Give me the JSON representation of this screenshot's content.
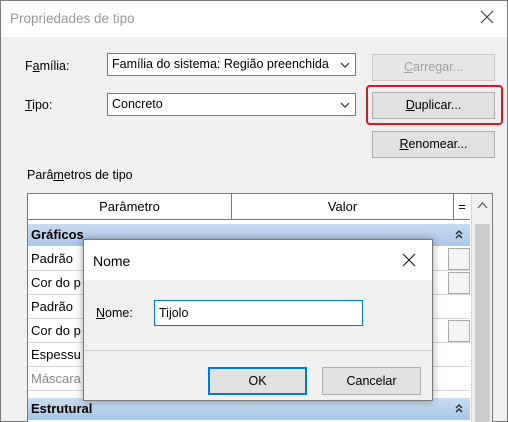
{
  "window": {
    "title": "Propriedades de tipo"
  },
  "familia": {
    "label_pre": "F",
    "label_u": "a",
    "label_post": "mília:",
    "value": "Família do sistema: Região preenchida"
  },
  "tipo": {
    "label_u": "T",
    "label_post": "ipo:",
    "value": "Concreto"
  },
  "buttons": {
    "carregar_u": "C",
    "carregar_post": "arregar...",
    "duplicar_u": "D",
    "duplicar_post": "uplicar...",
    "renomear_u": "R",
    "renomear_post": "enomear..."
  },
  "params_section": {
    "label_pre": "Parâ",
    "label_u": "m",
    "label_post": "etros de tipo"
  },
  "table": {
    "col_param": "Parâmetro",
    "col_valor": "Valor",
    "col_eq": "=",
    "groups": [
      {
        "label": "Gráficos"
      },
      {
        "label": "Estrutural"
      }
    ],
    "rows": [
      {
        "label": "Padrão"
      },
      {
        "label": "Cor do p"
      },
      {
        "label": "Padrão"
      },
      {
        "label": "Cor do p"
      },
      {
        "label": "Espessu"
      },
      {
        "label": "Máscara"
      }
    ]
  },
  "dialog": {
    "title": "Nome",
    "field_label_u": "N",
    "field_label_post": "ome:",
    "field_value": "Tijolo",
    "ok": "OK",
    "cancel": "Cancelar"
  },
  "colors": {
    "highlight": "#e0161f",
    "focus": "#0078d7",
    "group_header": "#b8d1eb"
  }
}
